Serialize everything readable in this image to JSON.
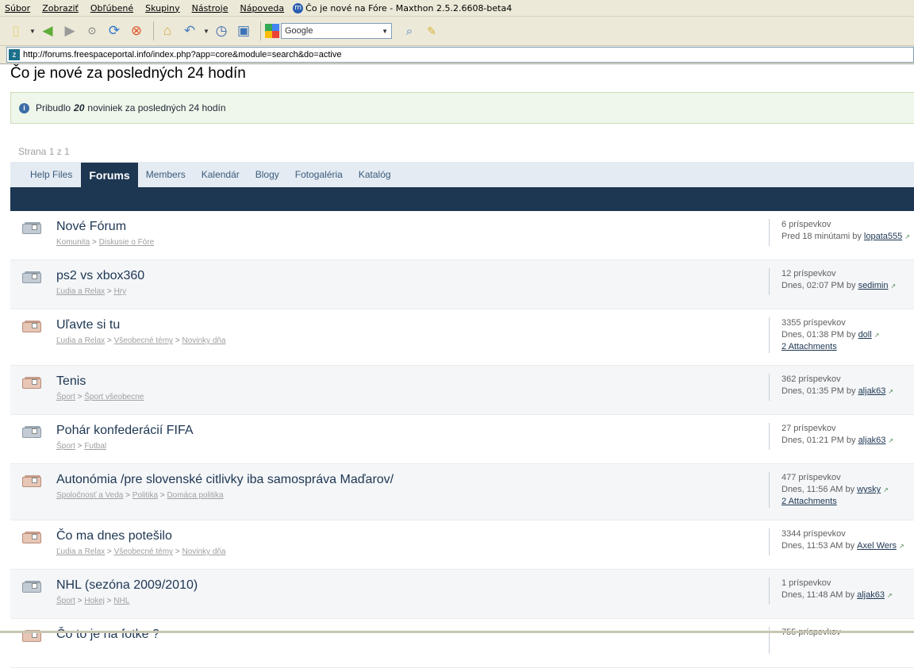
{
  "menu": {
    "items": [
      "Súbor",
      "Zobraziť",
      "Obľúbené",
      "Skupiny",
      "Nástroje",
      "Nápoveda"
    ],
    "window_title": "Čo je nové na Fóre - Maxthon 2.5.2.6608-beta4"
  },
  "toolbar": {
    "search_engine": "Google"
  },
  "address": {
    "url": "http://forums.freespaceportal.info/index.php?app=core&module=search&do=active"
  },
  "page": {
    "title": "Čo je nové za posledných 24 hodín",
    "info_prefix": "Pribudlo",
    "info_count": "20",
    "info_suffix": "noviniek za posledných 24 hodín",
    "pagination": "Strana 1 z 1"
  },
  "tabs": [
    {
      "label": "Help Files",
      "active": false
    },
    {
      "label": "Forums",
      "active": true
    },
    {
      "label": "Members",
      "active": false
    },
    {
      "label": "Kalendár",
      "active": false
    },
    {
      "label": "Blogy",
      "active": false
    },
    {
      "label": "Fotogaléria",
      "active": false
    },
    {
      "label": "Katalóg",
      "active": false
    }
  ],
  "topics": [
    {
      "title": "Nové Fórum",
      "crumbs": [
        "Komunita",
        "Diskusie o Fóre"
      ],
      "posts": "6 príspevkov",
      "when": "Pred 18 minútami by",
      "user": "lopata555",
      "attachments": "",
      "hot": false
    },
    {
      "title": "ps2 vs xbox360",
      "crumbs": [
        "Ľudia a Relax",
        "Hry"
      ],
      "posts": "12 príspevkov",
      "when": "Dnes, 02:07 PM by",
      "user": "sedimin",
      "attachments": "",
      "hot": false
    },
    {
      "title": "Uľavte si tu",
      "crumbs": [
        "Ľudia a Relax",
        "Všeobecné témy",
        "Novinky dňa"
      ],
      "posts": "3355 príspevkov",
      "when": "Dnes, 01:38 PM by",
      "user": "doll",
      "attachments": "2 Attachments",
      "hot": true
    },
    {
      "title": "Tenis",
      "crumbs": [
        "Šport",
        "Šport všeobecne"
      ],
      "posts": "362 príspevkov",
      "when": "Dnes, 01:35 PM by",
      "user": "aljak63",
      "attachments": "",
      "hot": true
    },
    {
      "title": "Pohár konfederácií FIFA",
      "crumbs": [
        "Šport",
        "Futbal"
      ],
      "posts": "27 príspevkov",
      "when": "Dnes, 01:21 PM by",
      "user": "aljak63",
      "attachments": "",
      "hot": false
    },
    {
      "title": "Autonómia /pre slovenské citlivky iba samospráva Maďarov/",
      "crumbs": [
        "Spoločnosť a Veda",
        "Politika",
        "Domáca politika"
      ],
      "posts": "477 príspevkov",
      "when": "Dnes, 11:56 AM by",
      "user": "wysky",
      "attachments": "2 Attachments",
      "hot": true
    },
    {
      "title": "Čo ma dnes potešilo",
      "crumbs": [
        "Ľudia a Relax",
        "Všeobecné témy",
        "Novinky dňa"
      ],
      "posts": "3344 príspevkov",
      "when": "Dnes, 11:53 AM by",
      "user": "Axel Wers",
      "attachments": "",
      "hot": true
    },
    {
      "title": "NHL (sezóna 2009/2010)",
      "crumbs": [
        "Šport",
        "Hokej",
        "NHL"
      ],
      "posts": "1 príspevkov",
      "when": "Dnes, 11:48 AM by",
      "user": "aljak63",
      "attachments": "",
      "hot": false
    },
    {
      "title": "Čo to je na fotke ?",
      "crumbs": [],
      "posts": "755 príspevkov",
      "when": "",
      "user": "",
      "attachments": "",
      "hot": true
    }
  ]
}
